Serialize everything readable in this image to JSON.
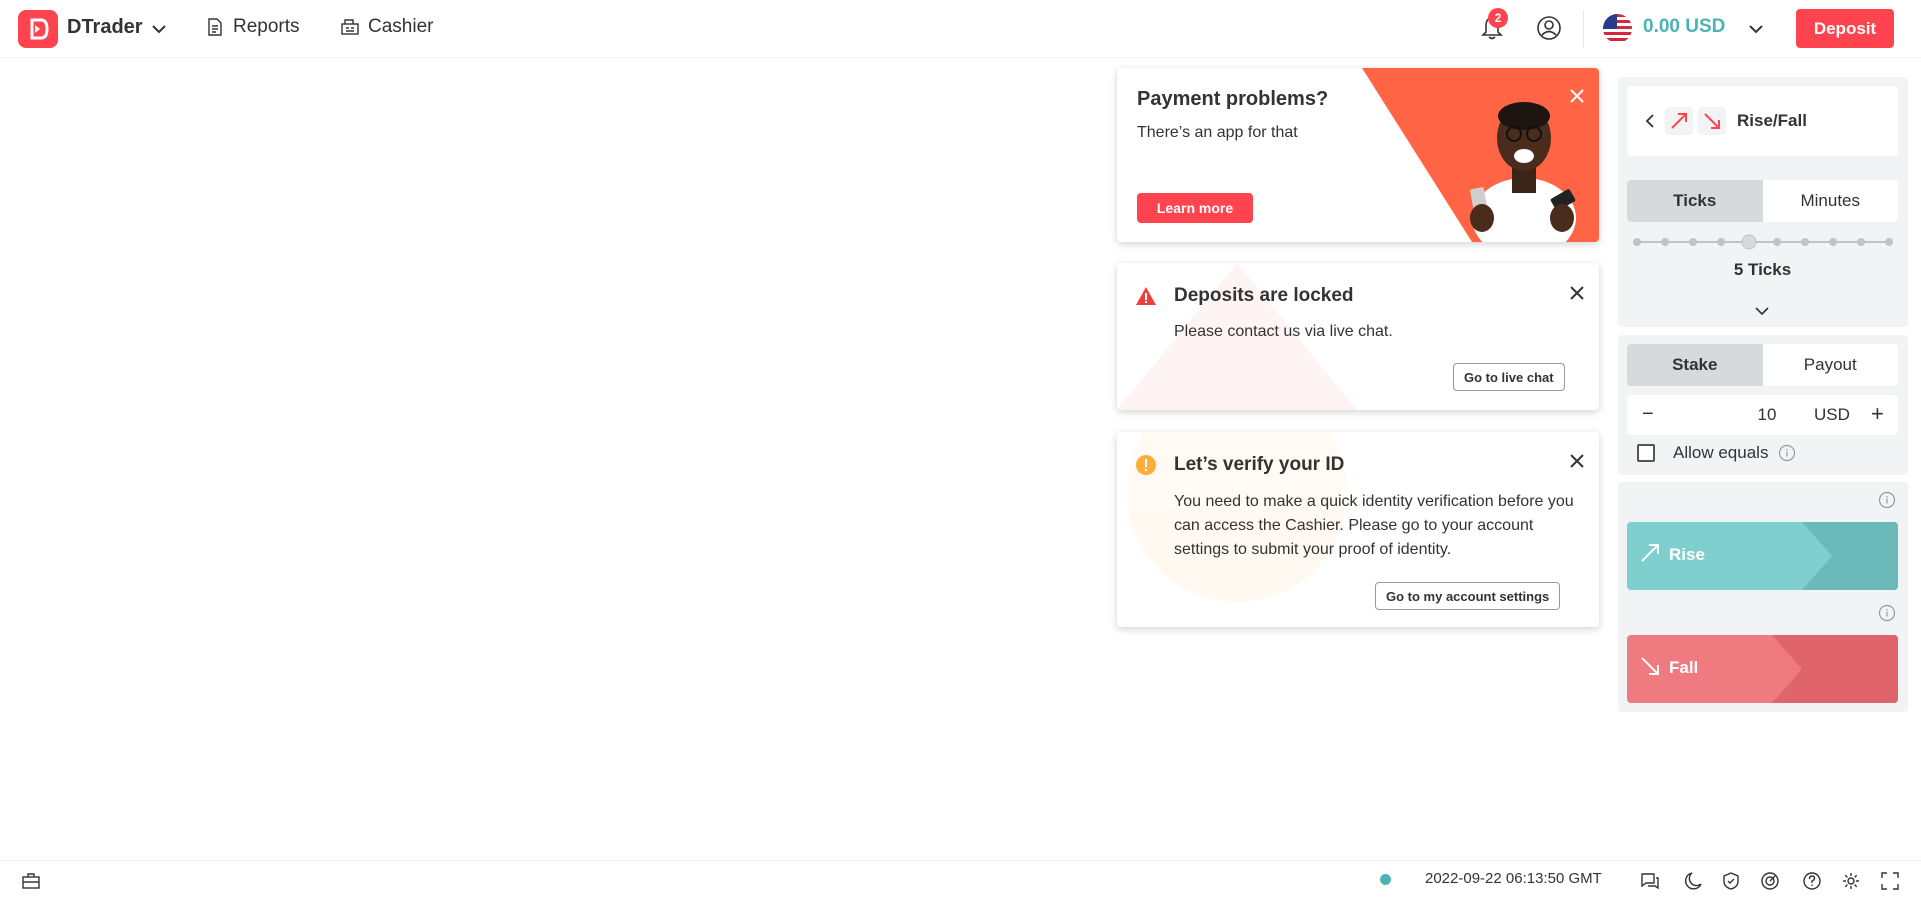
{
  "header": {
    "app_name": "DTrader",
    "nav": [
      {
        "label": "Reports",
        "icon": "reports-icon"
      },
      {
        "label": "Cashier",
        "icon": "cashier-icon"
      }
    ],
    "notification_count": "2",
    "balance": "0.00 USD",
    "deposit_label": "Deposit"
  },
  "promo": {
    "title": "Payment problems?",
    "subtitle": "There’s an app for that",
    "cta": "Learn more",
    "accent": "#ff6444"
  },
  "deposits_locked": {
    "title": "Deposits are locked",
    "text": "Please contact us via live chat.",
    "cta": "Go to live chat"
  },
  "verify": {
    "title": "Let’s verify your ID",
    "text": "You need to make a quick identity verification before you can access the Cashier. Please go to your account settings to submit your proof of identity.",
    "cta": "Go to my account settings"
  },
  "trade": {
    "contract_type": "Rise/Fall",
    "duration_tabs": [
      "Ticks",
      "Minutes"
    ],
    "duration_active": "Ticks",
    "duration_selected_index": 4,
    "duration_total_steps": 10,
    "duration_value": "5 Ticks",
    "amount_tabs": [
      "Stake",
      "Payout"
    ],
    "amount_active": "Stake",
    "stake": "10",
    "currency": "USD",
    "allow_equals": "Allow equals",
    "rise_label": "Rise",
    "fall_label": "Fall",
    "rise_color": "#7fcfcf",
    "fall_color": "#ef7a7f"
  },
  "footer": {
    "server_time": "2022-09-22 06:13:50 GMT",
    "status_color": "#4bb4b3"
  },
  "colors": {
    "brand": "#ff444f",
    "balance": "#4bb4b3"
  }
}
